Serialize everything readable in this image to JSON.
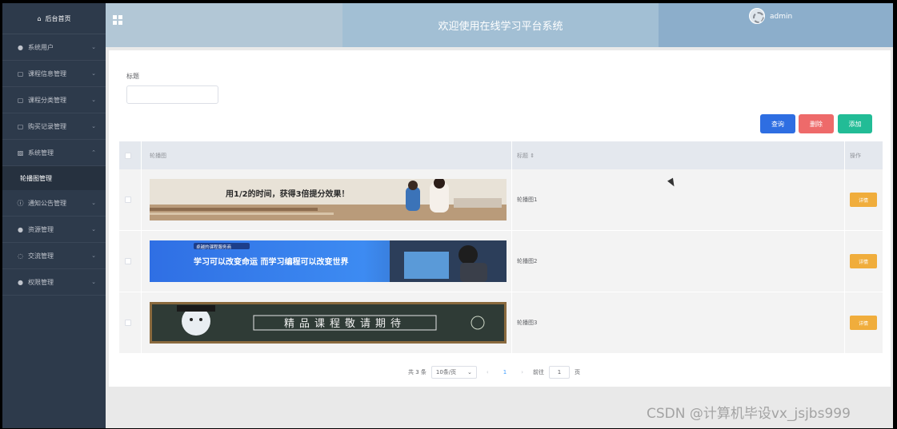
{
  "sidebar": {
    "home_label": "后台首页",
    "items": [
      {
        "label": "系统用户",
        "icon": "user-icon"
      },
      {
        "label": "课程信息管理",
        "icon": "doc-icon"
      },
      {
        "label": "课程分类管理",
        "icon": "doc-icon"
      },
      {
        "label": "购买记录管理",
        "icon": "doc-icon"
      },
      {
        "label": "系统管理",
        "icon": "chart-icon"
      }
    ],
    "active_sub": "轮播图管理",
    "items_after": [
      {
        "label": "通知公告管理",
        "icon": "info-icon"
      },
      {
        "label": "资源管理",
        "icon": "bulb-icon"
      },
      {
        "label": "交流管理",
        "icon": "chat-icon"
      },
      {
        "label": "权限管理",
        "icon": "user-icon"
      }
    ]
  },
  "header": {
    "title": "欢迎使用在线学习平台系统",
    "username": "admin"
  },
  "search": {
    "label": "标题",
    "value": "",
    "query_button": "查询",
    "delete_button": "删除",
    "add_button": "添加"
  },
  "table": {
    "columns": [
      "轮播图",
      "标题",
      "操作"
    ],
    "rows": [
      {
        "title": "轮播图1",
        "action": "详情",
        "banner_text": "用1/2的时间，获得3倍提分效果！"
      },
      {
        "title": "轮播图2",
        "action": "详情",
        "banner_text": "学习可以改变命运 而学习编程可以改变世界",
        "banner_tag": "卓越的课程服务商"
      },
      {
        "title": "轮播图3",
        "action": "详情",
        "banner_text": "精品课程敬请期待"
      }
    ]
  },
  "pagination": {
    "total": "共 3 条",
    "page_size": "10条/页",
    "current_page": "1",
    "goto_label": "前往",
    "goto_value": "1",
    "page_unit": "页"
  },
  "watermark": "CSDN @计算机毕设vx_jsjbs999",
  "colors": {
    "sidebar_bg": "#2d3a4b",
    "query": "#2e6ee2",
    "delete": "#ee6a6a",
    "add": "#22bc96",
    "detail": "#f0ad3c"
  }
}
